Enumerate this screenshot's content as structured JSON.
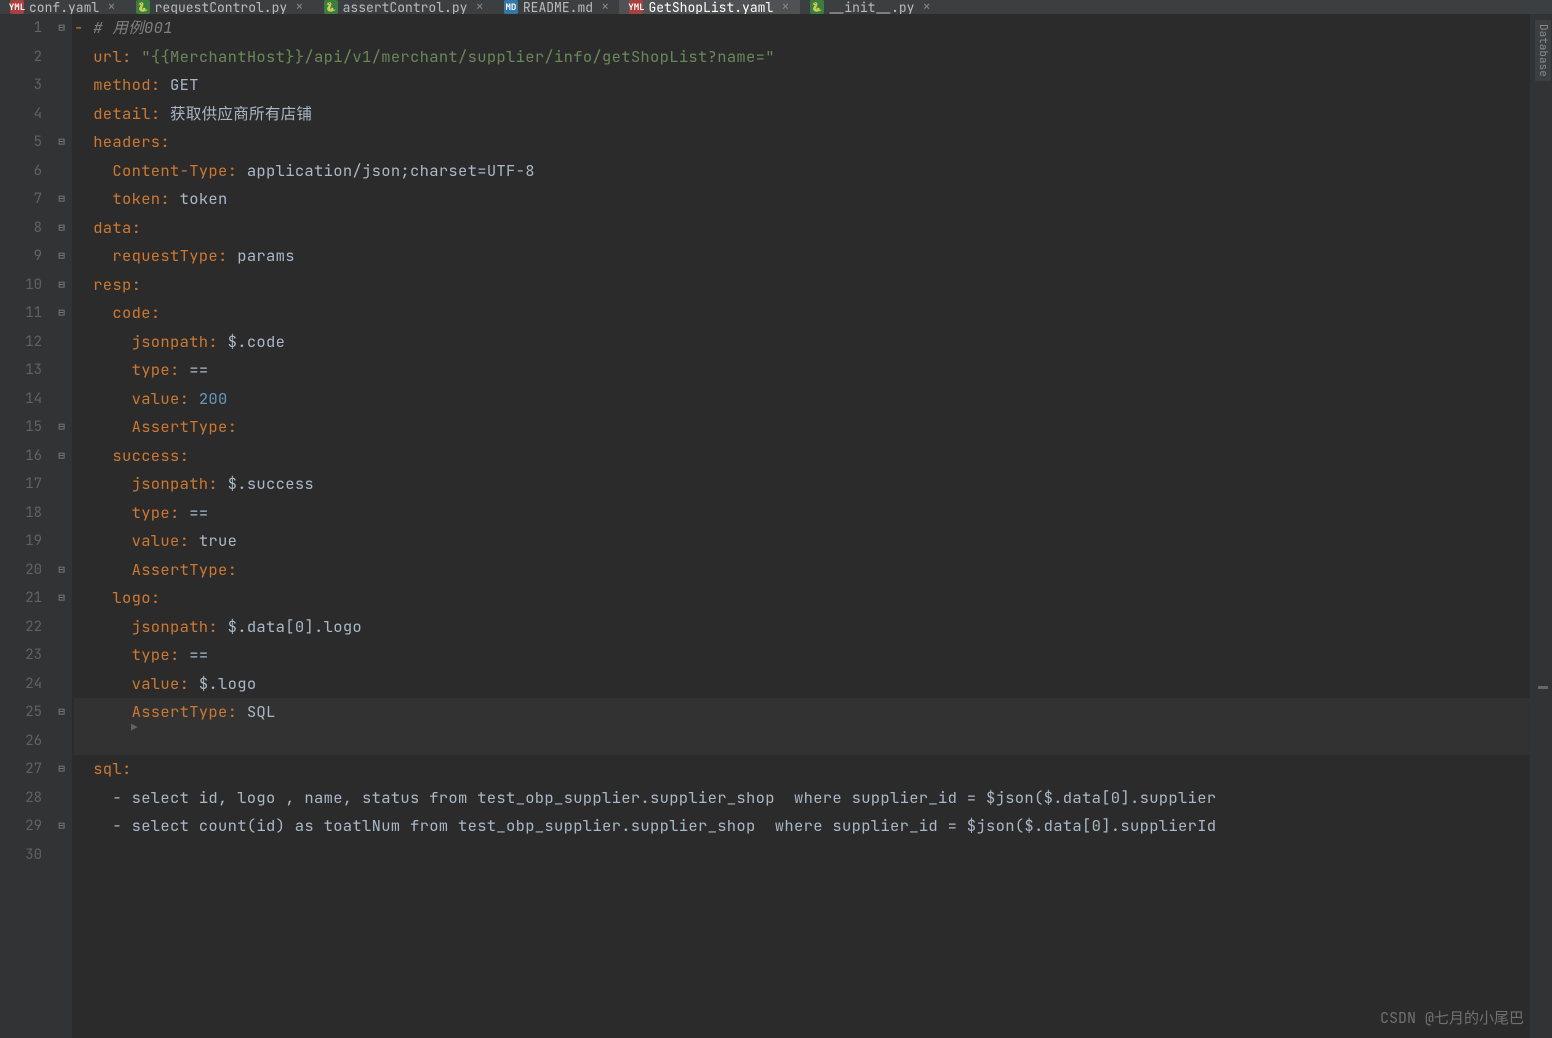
{
  "tabs": [
    {
      "icon": "YML",
      "iconClass": "icon-yaml",
      "label": "conf.yaml"
    },
    {
      "icon": "PY",
      "iconClass": "icon-py",
      "label": "requestControl.py"
    },
    {
      "icon": "PY",
      "iconClass": "icon-py",
      "label": "assertControl.py"
    },
    {
      "icon": "MD",
      "iconClass": "icon-md",
      "label": "README.md"
    },
    {
      "icon": "YML",
      "iconClass": "icon-yaml",
      "label": "GetShopList.yaml",
      "active": true
    },
    {
      "icon": "PY",
      "iconClass": "icon-py",
      "label": "__init__.py"
    }
  ],
  "gutterLines": [
    "1",
    "2",
    "3",
    "4",
    "5",
    "6",
    "7",
    "8",
    "9",
    "10",
    "11",
    "12",
    "13",
    "14",
    "15",
    "16",
    "17",
    "18",
    "19",
    "20",
    "21",
    "22",
    "23",
    "24",
    "25",
    "26",
    "27",
    "28",
    "29",
    "30"
  ],
  "code": {
    "l1_dash": "- ",
    "l1_cmt": "# 用例001",
    "l2_k": "url",
    "l2_v": "\"{{MerchantHost}}/api/v1/merchant/supplier/info/getShopList?name=\"",
    "l3_k": "method",
    "l3_v": "GET",
    "l4_k": "detail",
    "l4_v": "获取供应商所有店铺",
    "l5_k": "headers",
    "l6_k": "Content-Type",
    "l6_v": "application/json;charset=UTF-8",
    "l7_k": "token",
    "l7_v": "token",
    "l8_k": "data",
    "l9_k": "requestType",
    "l9_v": "params",
    "l10_k": "resp",
    "l11_k": "code",
    "l12_k": "jsonpath",
    "l12_v": "$.code",
    "l13_k": "type",
    "l13_v": "==",
    "l14_k": "value",
    "l14_v": "200",
    "l15_k": "AssertType",
    "l16_k": "success",
    "l17_k": "jsonpath",
    "l17_v": "$.success",
    "l18_k": "type",
    "l18_v": "==",
    "l19_k": "value",
    "l19_v": "true",
    "l20_k": "AssertType",
    "l21_k": "logo",
    "l22_k": "jsonpath",
    "l22_v": "$.data[0].logo",
    "l23_k": "type",
    "l23_v": "==",
    "l24_k": "value",
    "l24_v": "$.logo",
    "l25_k": "AssertType",
    "l25_v": "SQL",
    "l27_k": "sql",
    "l28": "- select id, logo , name, status from test_obp_supplier.supplier_shop  where supplier_id = $json($.data[0].supplier",
    "l29": "- select count(id) as toatlNum from test_obp_supplier.supplier_shop  where supplier_id = $json($.data[0].supplierId"
  },
  "watermark": "CSDN @七月的小尾巴",
  "sidebarLabel": "Database"
}
